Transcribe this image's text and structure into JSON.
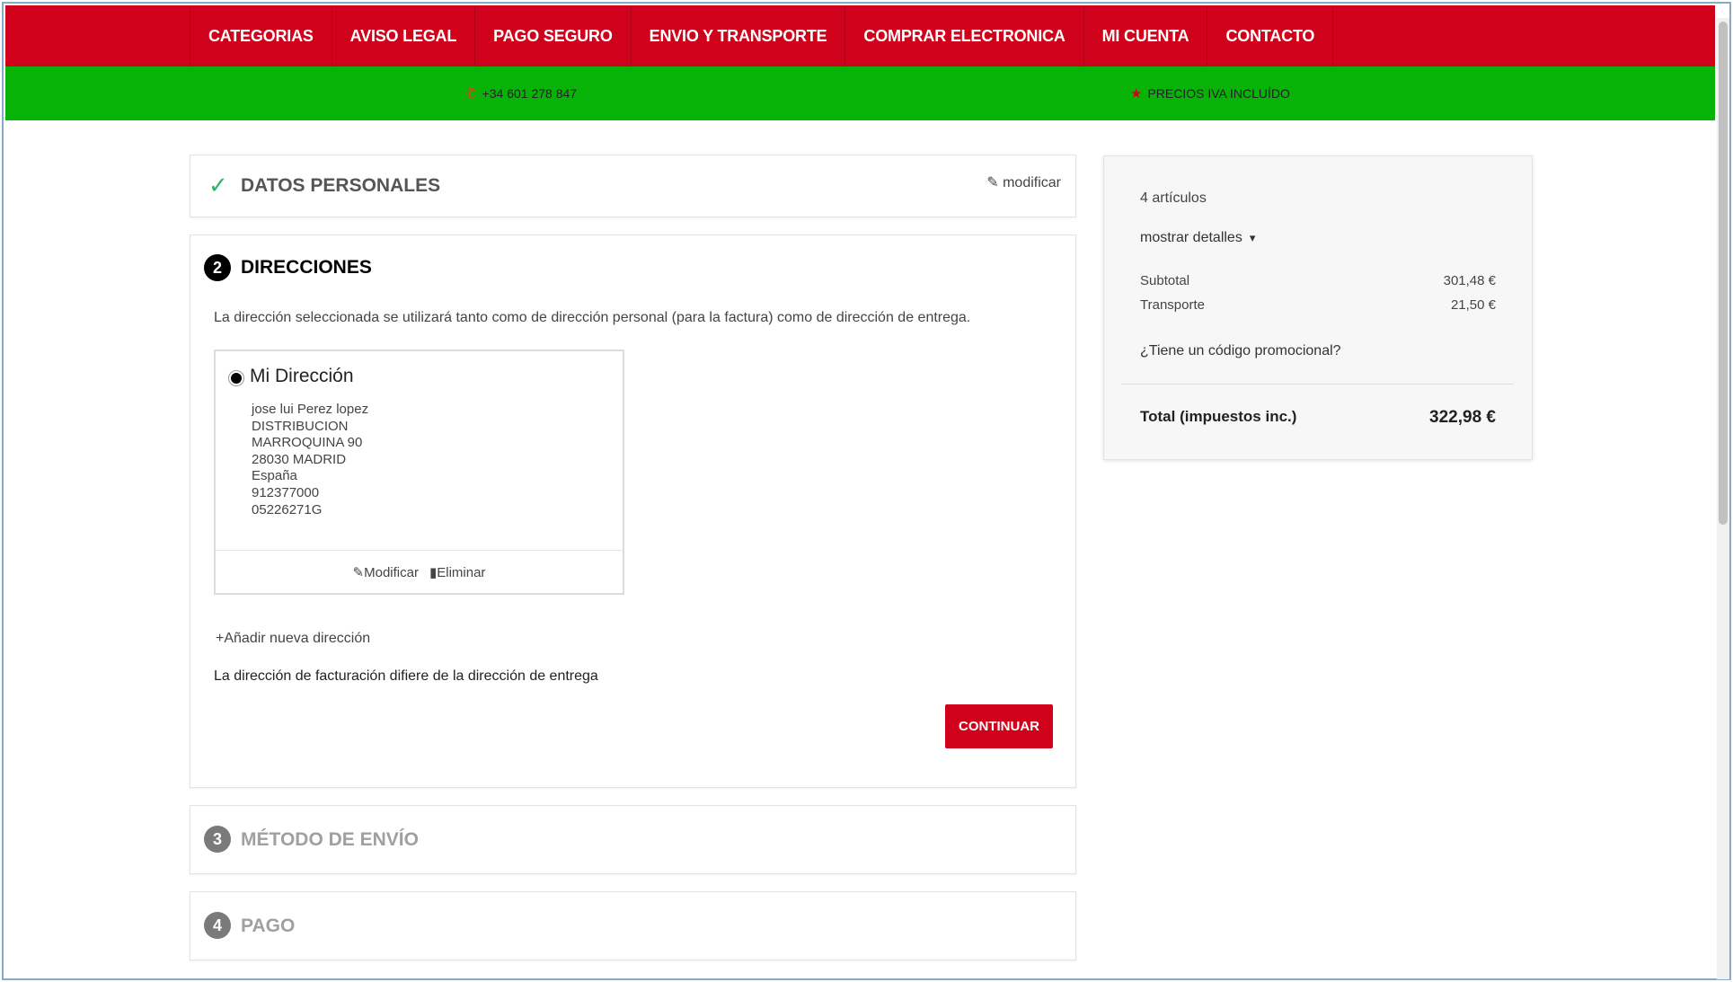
{
  "nav": {
    "items": [
      "CATEGORIAS",
      "AVISO LEGAL",
      "PAGO SEGURO",
      "ENVIO Y TRANSPORTE",
      "COMPRAR ELECTRONICA",
      "MI CUENTA",
      "CONTACTO"
    ]
  },
  "infobar": {
    "phone": "+34 601 278 847",
    "tax_note": "PRECIOS IVA INCLUÍDO"
  },
  "steps": {
    "personal": {
      "title": "DATOS PERSONALES",
      "edit_label": "modificar"
    },
    "addresses": {
      "number": "2",
      "title": "DIRECCIONES",
      "description": "La dirección seleccionada se utilizará tanto como de dirección personal (para la factura) como de dirección de entrega.",
      "address": {
        "alias": "Mi Dirección",
        "lines": [
          "jose lui Perez lopez",
          "DISTRIBUCION",
          "MARROQUINA 90",
          "28030 MADRID",
          "España",
          "912377000",
          "05226271G"
        ],
        "edit_label": "Modificar",
        "delete_label": "Eliminar"
      },
      "add_new_label": "Añadir nueva dirección",
      "billing_differs_label": "La dirección de facturación difiere de la dirección de entrega",
      "continue_label": "CONTINUAR"
    },
    "shipping": {
      "number": "3",
      "title": "MÉTODO DE ENVÍO"
    },
    "payment": {
      "number": "4",
      "title": "PAGO"
    }
  },
  "summary": {
    "item_count": "4 artículos",
    "show_details": "mostrar detalles",
    "subtotal_label": "Subtotal",
    "subtotal_value": "301,48 €",
    "shipping_label": "Transporte",
    "shipping_value": "21,50 €",
    "promo_label": "¿Tiene un código promocional?",
    "total_label": "Total (impuestos inc.)",
    "total_value": "322,98 €"
  },
  "colors": {
    "nav_red": "#d0021b",
    "info_green": "#08b308",
    "check_green": "#2fb36a"
  }
}
